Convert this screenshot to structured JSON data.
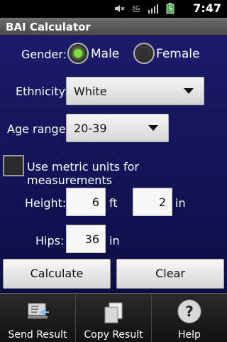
{
  "status_bar": {
    "time": "7:47",
    "icons": [
      "mute-icon",
      "signal-3g-icon",
      "signal-bars-icon",
      "battery-icon"
    ]
  },
  "app": {
    "title": "BAI Calculator"
  },
  "form": {
    "gender": {
      "label": "Gender:",
      "options": [
        "Male",
        "Female"
      ],
      "selected": "Male"
    },
    "ethnicity": {
      "label": "Ethnicity:",
      "value": "White"
    },
    "age_range": {
      "label": "Age range:",
      "value": "20-39"
    },
    "metric_checkbox": {
      "label": "Use metric units for measurements",
      "checked": false
    },
    "height": {
      "label": "Height:",
      "feet_value": "6",
      "feet_unit": "ft",
      "inches_value": "2",
      "inches_unit": "in"
    },
    "hips": {
      "label": "Hips:",
      "value": "36",
      "unit": "in"
    },
    "buttons": {
      "calculate": "Calculate",
      "clear": "Clear"
    }
  },
  "bottom_tabs": [
    {
      "label": "Send Result",
      "icon": "send-result-icon"
    },
    {
      "label": "Copy Result",
      "icon": "copy-result-icon"
    },
    {
      "label": "Help",
      "icon": "help-icon"
    }
  ],
  "colors": {
    "background_top": "#1b1b6a",
    "background_bottom": "#0d0d45",
    "radio_selected": "#7ee03a"
  }
}
